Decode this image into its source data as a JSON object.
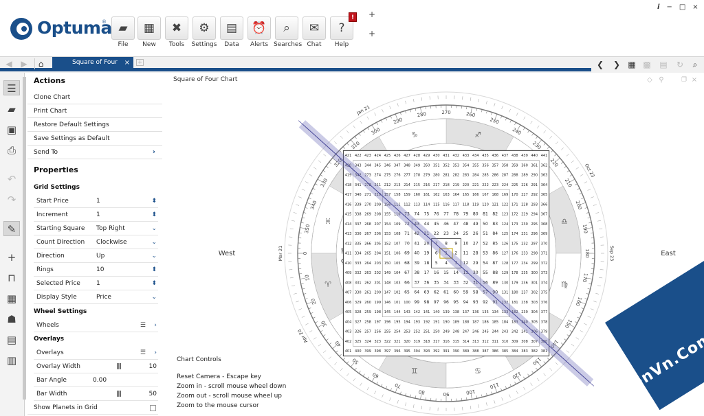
{
  "logo": {
    "text": "Optuma",
    "reg": "®"
  },
  "ribbon": {
    "buttons": [
      {
        "label": "File",
        "icon": "folder-icon"
      },
      {
        "label": "New",
        "icon": "new-chart-icon"
      },
      {
        "label": "Tools",
        "icon": "tools-icon"
      },
      {
        "label": "Settings",
        "icon": "settings-icon"
      },
      {
        "label": "Data",
        "icon": "data-icon"
      },
      {
        "label": "Alerts",
        "icon": "alarm-clock-icon"
      },
      {
        "label": "Searches",
        "icon": "search-icon"
      },
      {
        "label": "Chat",
        "icon": "chat-icon"
      },
      {
        "label": "Help",
        "icon": "help-icon"
      }
    ],
    "help_badge": "!",
    "plus": "+",
    "window": {
      "info": "i",
      "minimize": "−",
      "maximize": "□",
      "close": "×"
    }
  },
  "tabbar": {
    "tab_label": "Square of Four",
    "tab_close": "×",
    "new_tab": "+"
  },
  "actions": {
    "title": "Actions",
    "items": [
      "Clone Chart",
      "Print Chart",
      "Restore Default Settings",
      "Save Settings as Default",
      "Send To"
    ]
  },
  "properties": {
    "title": "Properties",
    "grid_settings": "Grid Settings",
    "rows": [
      {
        "key": "Start Price",
        "value": "1"
      },
      {
        "key": "Increment",
        "value": "1"
      },
      {
        "key": "Starting Square",
        "value": "Top Right"
      },
      {
        "key": "Count Direction",
        "value": "Clockwise"
      },
      {
        "key": "Direction",
        "value": "Up"
      },
      {
        "key": "Rings",
        "value": "10"
      },
      {
        "key": "Selected Price",
        "value": "1"
      },
      {
        "key": "Display Style",
        "value": "Price"
      }
    ],
    "wheel_settings": "Wheel Settings",
    "wheels": "Wheels",
    "overlays_section": "Overlays",
    "overlays": "Overlays",
    "overlay_width": {
      "key": "Overlay Width",
      "value": "10"
    },
    "bar_angle": {
      "key": "Bar Angle",
      "value": "0.00"
    },
    "bar_width": {
      "key": "Bar Width",
      "value": "50"
    },
    "show_planets": "Show Planets in Grid"
  },
  "chart": {
    "title": "Square of Four Chart",
    "west": "West",
    "east": "East",
    "deg_labels": [
      {
        "t": "0",
        "a": 180
      },
      {
        "t": "10",
        "a": 190
      },
      {
        "t": "20",
        "a": 200
      },
      {
        "t": "30",
        "a": 210
      },
      {
        "t": "40",
        "a": 220
      },
      {
        "t": "50",
        "a": 230
      },
      {
        "t": "60",
        "a": 240
      },
      {
        "t": "70",
        "a": 250
      },
      {
        "t": "80",
        "a": 260
      },
      {
        "t": "90",
        "a": 270
      },
      {
        "t": "100",
        "a": 280
      },
      {
        "t": "110",
        "a": 290
      },
      {
        "t": "120",
        "a": 300
      },
      {
        "t": "130",
        "a": 310
      },
      {
        "t": "140",
        "a": 320
      },
      {
        "t": "150",
        "a": 330
      },
      {
        "t": "160",
        "a": 340
      },
      {
        "t": "170",
        "a": 350
      },
      {
        "t": "180",
        "a": 0
      },
      {
        "t": "190",
        "a": 10
      },
      {
        "t": "200",
        "a": 20
      },
      {
        "t": "210",
        "a": 30
      },
      {
        "t": "220",
        "a": 40
      },
      {
        "t": "230",
        "a": 50
      },
      {
        "t": "240",
        "a": 60
      },
      {
        "t": "250",
        "a": 70
      },
      {
        "t": "260",
        "a": 80
      },
      {
        "t": "270",
        "a": 90
      },
      {
        "t": "280",
        "a": 100
      },
      {
        "t": "290",
        "a": 110
      },
      {
        "t": "300",
        "a": 120
      },
      {
        "t": "310",
        "a": 130
      },
      {
        "t": "320",
        "a": 140
      },
      {
        "t": "330",
        "a": 150
      },
      {
        "t": "340",
        "a": 160
      },
      {
        "t": "350",
        "a": 170
      }
    ],
    "date_labels": [
      {
        "t": "Mar 21",
        "a": 180
      },
      {
        "t": "Apr 20",
        "a": 210
      },
      {
        "t": "Sep 23",
        "a": 0
      },
      {
        "t": "Oct 23",
        "a": 30
      },
      {
        "t": "Jan 21",
        "a": 120
      }
    ],
    "zodiac": [
      "♈",
      "♉",
      "♊",
      "♋",
      "♌",
      "♍",
      "♎",
      "♏",
      "♐",
      "♑",
      "♒",
      "♓"
    ],
    "planets": [
      {
        "t": "♂",
        "a": 315,
        "r": 150
      },
      {
        "t": "☿",
        "a": 237,
        "r": 150
      },
      {
        "t": "♇",
        "a": 236,
        "r": 166
      },
      {
        "t": "♅",
        "a": 197,
        "r": 150
      },
      {
        "t": "♀",
        "a": 185,
        "r": 150
      },
      {
        "t": "♄",
        "a": 179,
        "r": 150
      }
    ],
    "rings": 10,
    "selected_square": "1"
  },
  "chart_controls": {
    "title": "Chart Controls",
    "lines": [
      "Reset Camera - Escape key",
      "Zoom in - scroll mouse wheel down",
      "Zoom out - scroll mouse wheel up",
      "Zoom to the mouse cursor"
    ]
  },
  "watermark": "XenVn.Com"
}
